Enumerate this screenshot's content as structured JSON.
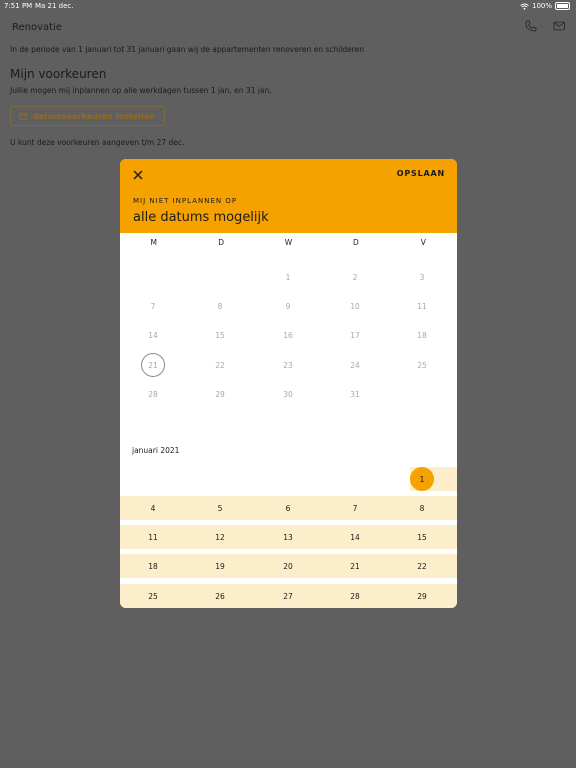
{
  "status": {
    "time": "7:51 PM",
    "date": "Ma 21 dec.",
    "battery": "100%"
  },
  "page": {
    "title": "Renovatie",
    "intro": "In de periode van 1 januari tot 31 januari gaan wij de appartementen renoveren en schilderen",
    "section_title": "Mijn voorkeuren",
    "section_sub": "Jullie mogen mij inplannen op alle werkdagen tussen 1 jan. en 31 jan.",
    "pref_button": "datumvoorkeuren instellen",
    "deadline": "U kunt deze voorkeuren aangeven t/m 27 dec."
  },
  "icons": {
    "phone": "phone-icon",
    "mail": "mail-icon",
    "calendar": "calendar-icon",
    "close": "close-icon",
    "wifi": "wifi-icon",
    "battery": "battery-icon"
  },
  "modal": {
    "save_label": "OPSLAAN",
    "header_label": "MIJ NIET INPLANNEN OP",
    "header_value": "alle datums mogelijk",
    "weekdays": [
      "M",
      "D",
      "W",
      "D",
      "V"
    ],
    "december_weeks": [
      [
        "",
        "1",
        "2",
        "3",
        "4"
      ],
      [
        "7",
        "8",
        "9",
        "10",
        "11"
      ],
      [
        "14",
        "15",
        "16",
        "17",
        "18"
      ],
      [
        "21",
        "22",
        "23",
        "24",
        "25"
      ],
      [
        "28",
        "29",
        "30",
        "31",
        ""
      ]
    ],
    "today": "21",
    "month_label": "januari 2021",
    "january_weeks": [
      [
        "",
        "",
        "",
        "",
        "1"
      ],
      [
        "4",
        "5",
        "6",
        "7",
        "8"
      ],
      [
        "11",
        "12",
        "13",
        "14",
        "15"
      ],
      [
        "18",
        "19",
        "20",
        "21",
        "22"
      ],
      [
        "25",
        "26",
        "27",
        "28",
        "29"
      ]
    ],
    "selected": "1"
  },
  "colors": {
    "accent": "#f5a200",
    "band": "#fdeecb",
    "overlay": "#5f5f5f"
  }
}
